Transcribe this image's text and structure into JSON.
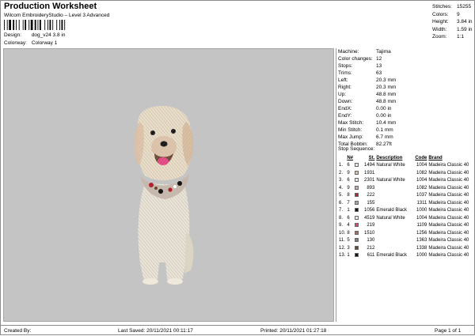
{
  "header": {
    "title": "Production Worksheet",
    "subtitle": "Wilcom EmbroideryStudio – Level 3 Advanced",
    "design_label": "Design:",
    "design_value": "dog_v24 3.8 in",
    "colorway_label": "Colorway:",
    "colorway_value": "Colorway 1"
  },
  "stats": [
    {
      "label": "Stitches:",
      "value": "15255"
    },
    {
      "label": "Colors:",
      "value": "9"
    },
    {
      "label": "Height:",
      "value": "3.84 in"
    },
    {
      "label": "Width:",
      "value": "1.59 in"
    },
    {
      "label": "Zoom:",
      "value": "1:1"
    }
  ],
  "info": [
    {
      "label": "Machine:",
      "value": "Tajima"
    },
    {
      "label": "Color changes:",
      "value": "12"
    },
    {
      "label": "Stops:",
      "value": "13"
    },
    {
      "label": "Trims:",
      "value": "63"
    },
    {
      "label": "Left:",
      "value": "20.3 mm"
    },
    {
      "label": "Right:",
      "value": "20.3 mm"
    },
    {
      "label": "Up:",
      "value": "48.8 mm"
    },
    {
      "label": "Down:",
      "value": "48.8 mm"
    },
    {
      "label": "EndX:",
      "value": "0.00 in"
    },
    {
      "label": "EndY:",
      "value": "0.00 in"
    },
    {
      "label": "Max Stitch:",
      "value": "10.4 mm"
    },
    {
      "label": "Min Stitch:",
      "value": "0.1 mm"
    },
    {
      "label": "Max Jump:",
      "value": "6.7 mm"
    },
    {
      "label": "Total Bobbin:",
      "value": "82.27ft"
    }
  ],
  "sequence": {
    "title": "Stop Sequence:",
    "headers": {
      "n": "N#",
      "st": "St.",
      "description": "Description",
      "code": "Code",
      "brand": "Brand"
    },
    "rows": [
      {
        "stop": "1.",
        "n": "6",
        "color": "#efe9dc",
        "st": "1494",
        "description": "Natural White",
        "code": "1004",
        "brand": "Madeira Classic 40"
      },
      {
        "stop": "2.",
        "n": "9",
        "color": "#d9c0a6",
        "st": "1931",
        "description": "",
        "code": "1082",
        "brand": "Madeira Classic 40"
      },
      {
        "stop": "3.",
        "n": "6",
        "color": "#efe9dc",
        "st": "2301",
        "description": "Natural White",
        "code": "1004",
        "brand": "Madeira Classic 40"
      },
      {
        "stop": "4.",
        "n": "9",
        "color": "#c9a6c4",
        "st": "893",
        "description": "",
        "code": "1082",
        "brand": "Madeira Classic 40"
      },
      {
        "stop": "5.",
        "n": "8",
        "color": "#b3202e",
        "st": "222",
        "description": "",
        "code": "1037",
        "brand": "Madeira Classic 40"
      },
      {
        "stop": "6.",
        "n": "7",
        "color": "#a8a8b0",
        "st": "155",
        "description": "",
        "code": "1311",
        "brand": "Madeira Classic 40"
      },
      {
        "stop": "7.",
        "n": "1",
        "color": "#141414",
        "st": "1056",
        "description": "Emerald Black",
        "code": "1000",
        "brand": "Madeira Classic 40"
      },
      {
        "stop": "8.",
        "n": "6",
        "color": "#efe9dc",
        "st": "4519",
        "description": "Natural White",
        "code": "1004",
        "brand": "Madeira Classic 40"
      },
      {
        "stop": "9.",
        "n": "4",
        "color": "#e0457f",
        "st": "219",
        "description": "",
        "code": "1109",
        "brand": "Madeira Classic 40"
      },
      {
        "stop": "10.",
        "n": "8",
        "color": "#b07050",
        "st": "1510",
        "description": "",
        "code": "1256",
        "brand": "Madeira Classic 40"
      },
      {
        "stop": "11.",
        "n": "5",
        "color": "#8a7a84",
        "st": "130",
        "description": "",
        "code": "1363",
        "brand": "Madeira Classic 40"
      },
      {
        "stop": "12.",
        "n": "3",
        "color": "#6a4634",
        "st": "212",
        "description": "",
        "code": "1338",
        "brand": "Madeira Classic 40"
      },
      {
        "stop": "13.",
        "n": "1",
        "color": "#141414",
        "st": "611",
        "description": "Emerald Black",
        "code": "1000",
        "brand": "Madeira Classic 40"
      }
    ]
  },
  "footer": {
    "created_by": "Created By:",
    "last_saved": "Last Saved: 20/11/2021 00:11:17",
    "printed": "Printed: 20/11/2021 01:27:18",
    "page": "Page 1 of 1"
  }
}
